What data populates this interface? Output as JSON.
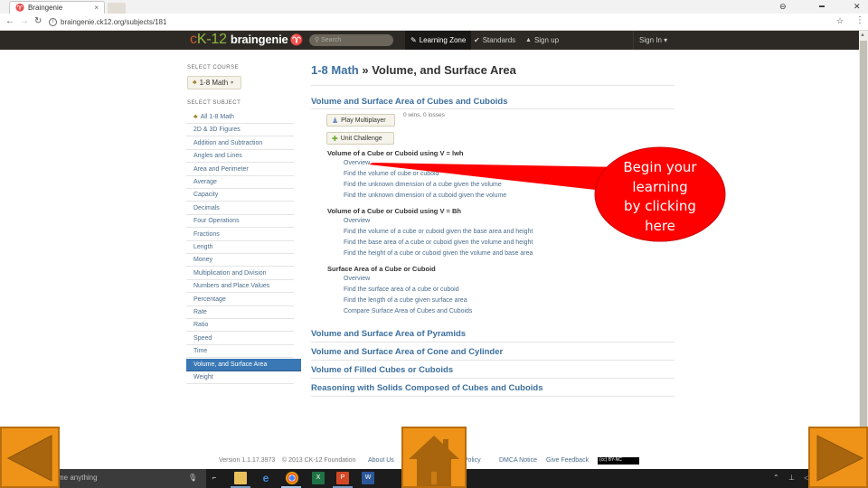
{
  "browser": {
    "tab_title": "Braingenie",
    "tab_close": "×",
    "url": "braingenie.ck12.org/subjects/181",
    "window_controls": {
      "profile": "⊖",
      "minimize": "▬",
      "close": "✕"
    }
  },
  "navbar": {
    "logo": {
      "c": "c",
      "k": "K",
      "n12": "-12",
      "brand": "braingenie",
      "genie_icon": "♈"
    },
    "search_placeholder": "Search",
    "items": [
      {
        "icon": "✎",
        "label": "Learning Zone",
        "active": true
      },
      {
        "icon": "✔",
        "label": "Standards",
        "active": false
      },
      {
        "icon": "👤",
        "label": "Sign up",
        "active": false
      }
    ],
    "sign_in": "Sign In ▾"
  },
  "sidebar": {
    "course_label": "SELECT COURSE",
    "course_value": "1-8 Math",
    "subject_label": "SELECT SUBJECT",
    "subjects": [
      "All 1-8 Math",
      "2D & 3D Figures",
      "Addition and Subtraction",
      "Angles and Lines",
      "Area and Perimeter",
      "Average",
      "Capacity",
      "Decimals",
      "Four Operations",
      "Fractions",
      "Length",
      "Money",
      "Multiplication and Division",
      "Numbers and Place Values",
      "Percentage",
      "Rate",
      "Ratio",
      "Speed",
      "Time",
      "Volume, and Surface Area",
      "Weight"
    ],
    "active_subject": "Volume, and Surface Area"
  },
  "main": {
    "breadcrumb_course": "1-8 Math",
    "breadcrumb_sep": " » ",
    "page_title": "Volume, and Surface Area",
    "first_unit": {
      "title": "Volume and Surface Area of Cubes and Cuboids",
      "play_multiplayer": "Play Multiplayer",
      "unit_challenge": "Unit Challenge",
      "record": "0 wins, 0 losses",
      "concepts": [
        {
          "title": "Volume of a Cube or Cuboid using V = lwh",
          "lessons": [
            "Overview",
            "Find the volume of cube or cuboid",
            "Find the unknown dimension of a cube given the volume",
            "Find the unknown dimension of a cuboid given the volume"
          ]
        },
        {
          "title": "Volume of a Cube or Cuboid using V = Bh",
          "lessons": [
            "Overview",
            "Find the volume of a cube or cuboid given the base area and height",
            "Find the base area of a cube or cuboid given the volume and height",
            "Find the height of a cube or cuboid given the volume and base area"
          ]
        },
        {
          "title": "Surface Area of a Cube or Cuboid",
          "lessons": [
            "Overview",
            "Find the surface area of a cube or cuboid",
            "Find the length of a cube given surface area",
            "Compare Surface Area of Cubes and Cuboids"
          ]
        }
      ]
    },
    "other_units": [
      "Volume and Surface Area of Pyramids",
      "Volume and Surface Area of Cone and Cylinder",
      "Volume of Filled Cubes or Cuboids",
      "Reasoning with Solids Composed of Cubes and Cuboids"
    ]
  },
  "footer": {
    "version": "Version 1.1.17.3973",
    "copyright": "© 2013 CK-12 Foundation",
    "about": "About Us",
    "privacy": "Privacy Policy",
    "dmca": "DMCA Notice",
    "feedback": "Give Feedback",
    "license_badge": "(cc) BY-NC"
  },
  "taskbar": {
    "search_text": "me anything",
    "apps": [
      "task-view",
      "file-explorer",
      "edge",
      "chrome",
      "excel",
      "powerpoint",
      "word"
    ]
  },
  "callout": {
    "text": "Begin your learning by clicking here",
    "lines": [
      "Begin your",
      "learning",
      "by clicking",
      "here"
    ],
    "color": "#ff0000"
  },
  "slide_nav": {
    "back": "Previous slide",
    "home": "Home",
    "forward": "Next slide",
    "color": "#ee9317"
  }
}
